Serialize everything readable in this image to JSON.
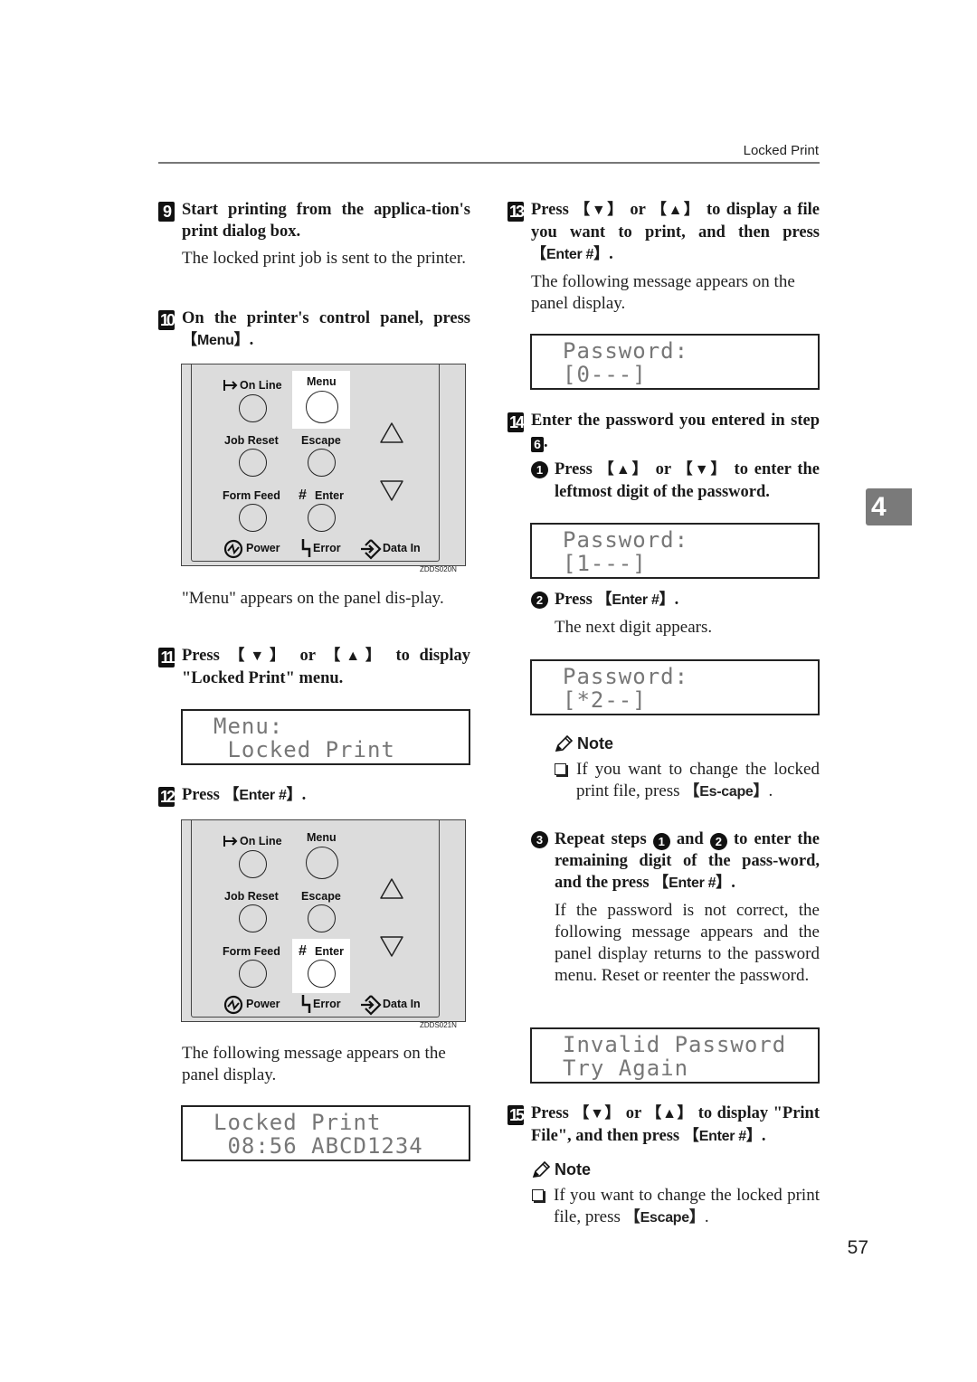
{
  "header": {
    "running_title": "Locked Print"
  },
  "chapter_tab": "4",
  "page_number": "57",
  "left_column": {
    "step9": {
      "number": "9",
      "title": "Start printing from the applica-tion's print dialog box.",
      "body": "The locked print job is sent to the printer."
    },
    "step10": {
      "number": "10",
      "title_prefix": "On the printer's control panel, press ",
      "key": "Menu",
      "title_suffix": ".",
      "figure_id": "ZDDS020N",
      "after": "\"Menu\" appears on the panel dis-play."
    },
    "step11": {
      "number": "11",
      "title_prefix": "Press ",
      "key_down": "▼",
      "or": " or ",
      "key_up": "▲",
      "title_suffix": " to display \"Locked Print\" menu.",
      "lcd": {
        "line1": "Menu:",
        "line2": " Locked Print"
      }
    },
    "step12": {
      "number": "12",
      "title_prefix": "Press ",
      "key": "Enter #",
      "title_suffix": ".",
      "figure_id": "ZDDS021N",
      "after": "The following message appears on the panel display.",
      "lcd": {
        "line1": "Locked Print",
        "line2": " 08:56 ABCD1234"
      }
    }
  },
  "control_panel": {
    "buttons": {
      "on_line": "On Line",
      "menu": "Menu",
      "job_reset": "Job Reset",
      "escape": "Escape",
      "form_feed": "Form Feed",
      "enter": "Enter"
    },
    "indicators": {
      "power": "Power",
      "error": "Error",
      "data_in": "Data In"
    },
    "icons": [
      "on-line-arrow-icon",
      "hash-icon",
      "power-icon",
      "error-icon",
      "data-in-icon",
      "up-arrow-icon",
      "down-arrow-icon"
    ]
  },
  "right_column": {
    "step13": {
      "number": "13",
      "title_prefix": "Press ",
      "key_down": "▼",
      "or": " or ",
      "key_up": "▲",
      "title_mid": " to display a file you want to print, and then press ",
      "key": "Enter #",
      "title_suffix": ".",
      "body": "The following message appears on the panel display.",
      "lcd": {
        "line1": "Password:",
        "line2": "[0---]"
      }
    },
    "step14": {
      "number": "14",
      "title_prefix": "Enter the password you entered in step ",
      "ref_step": "6",
      "title_suffix": ".",
      "sub1": {
        "number": "1",
        "title_prefix": "Press ",
        "key_up": "▲",
        "or": " or ",
        "key_down": "▼",
        "title_suffix": " to enter the leftmost digit of the password.",
        "lcd": {
          "line1": "Password:",
          "line2": "[1---]"
        }
      },
      "sub2": {
        "number": "2",
        "title_prefix": "Press ",
        "key": "Enter #",
        "title_suffix": ".",
        "body": "The next digit appears.",
        "lcd": {
          "line1": "Password:",
          "line2": "[*2--]"
        },
        "note": {
          "heading": "Note",
          "item_prefix": "If you want to change the locked print file, press ",
          "key": "Es-cape",
          "item_suffix": "."
        }
      },
      "sub3": {
        "number": "3",
        "title_a": "Repeat steps ",
        "ref1": "1",
        "title_b": " and ",
        "ref2": "2",
        "title_c": " to enter the remaining digit of the pass-word, and the press ",
        "key": "Enter #",
        "title_suffix": ".",
        "body": "If the password is not correct, the following message appears and the panel display returns to the password menu. Reset or reenter the password.",
        "lcd": {
          "line1": "Invalid Password",
          "line2": "Try Again"
        }
      }
    },
    "step15": {
      "number": "15",
      "title_prefix": "Press ",
      "key_down": "▼",
      "or": " or ",
      "key_up": "▲",
      "title_mid": " to display \"Print File\", and then press ",
      "key": "Enter #",
      "title_suffix": ".",
      "note": {
        "heading": "Note",
        "item_prefix": "If you want to change the locked print file, press ",
        "key": "Escape",
        "item_suffix": "."
      }
    }
  }
}
